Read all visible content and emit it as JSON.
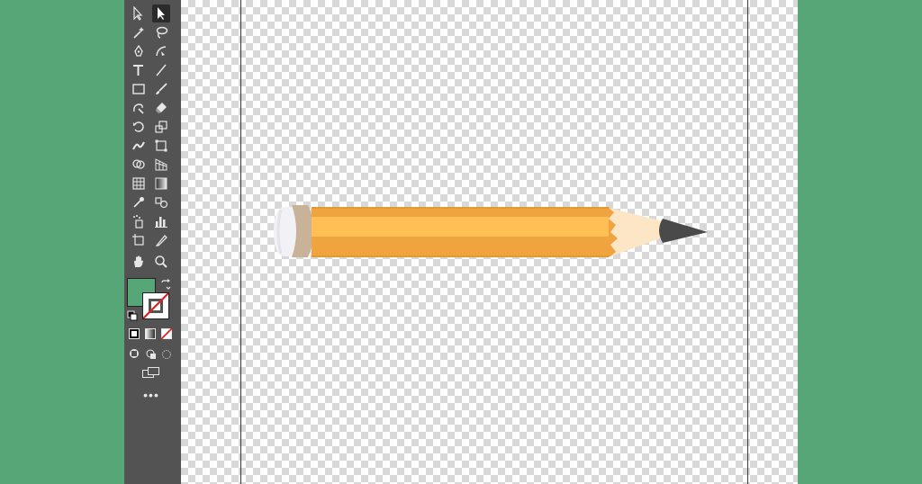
{
  "colors": {
    "page_background": "#57a678",
    "toolbar": "#535353",
    "fill_color": "#57a678",
    "stroke_color": "none",
    "pencil_body": "#efa43f",
    "pencil_highlight": "#ffbf55",
    "pencil_tip_wood": "#fde6c6",
    "pencil_lead": "#4a4a4a",
    "pencil_ferrule": "#c9b398",
    "pencil_eraser": "#f2f2f6"
  },
  "tools": [
    {
      "name": "direct-selection-tool-icon"
    },
    {
      "name": "selection-tool-icon",
      "active": true
    },
    {
      "name": "magic-wand-tool-icon"
    },
    {
      "name": "lasso-tool-icon"
    },
    {
      "name": "pen-tool-icon"
    },
    {
      "name": "curvature-tool-icon"
    },
    {
      "name": "type-tool-icon"
    },
    {
      "name": "line-segment-tool-icon"
    },
    {
      "name": "rectangle-tool-icon"
    },
    {
      "name": "paintbrush-tool-icon"
    },
    {
      "name": "shaper-tool-icon"
    },
    {
      "name": "eraser-tool-icon"
    },
    {
      "name": "rotate-tool-icon"
    },
    {
      "name": "scale-tool-icon"
    },
    {
      "name": "width-tool-icon"
    },
    {
      "name": "free-transform-tool-icon"
    },
    {
      "name": "shape-builder-tool-icon"
    },
    {
      "name": "perspective-grid-tool-icon"
    },
    {
      "name": "mesh-tool-icon"
    },
    {
      "name": "gradient-tool-icon"
    },
    {
      "name": "eyedropper-tool-icon"
    },
    {
      "name": "blend-tool-icon"
    },
    {
      "name": "symbol-sprayer-tool-icon"
    },
    {
      "name": "column-graph-tool-icon"
    },
    {
      "name": "artboard-tool-icon"
    },
    {
      "name": "slice-tool-icon"
    },
    {
      "name": "hand-tool-icon"
    },
    {
      "name": "zoom-tool-icon"
    }
  ],
  "toolbar_more": "•••"
}
